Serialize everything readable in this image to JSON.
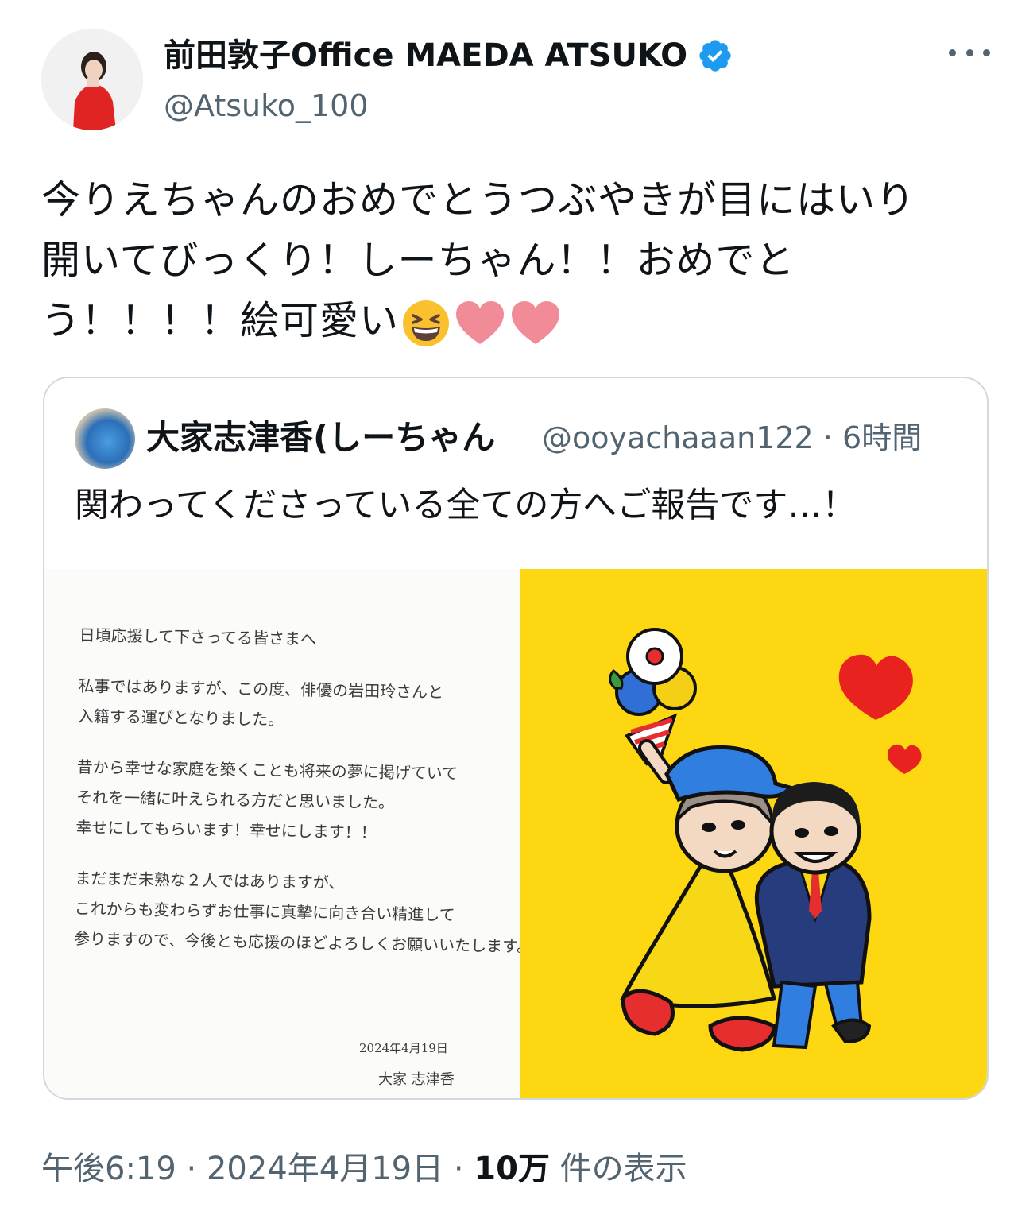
{
  "author": {
    "display_name": "前田敦子Office MAEDA ATSUKO",
    "handle": "@Atsuko_100"
  },
  "tweet": {
    "lines": [
      "今りえちゃんのおめでとうつぶやきが目にはいり",
      "開いてびっくり！しーちゃん！！おめでと",
      "う！！！！絵可愛い"
    ],
    "emojis": [
      "grinning-squinting-face",
      "pink-heart",
      "pink-heart"
    ]
  },
  "quote": {
    "display_name": "大家志津香(しーちゃん",
    "handle": "@ooyachaaan122",
    "separator": "·",
    "time": "6時間",
    "text": "関わってくださっている全ての方へご報告です…！",
    "letter": {
      "lines": [
        "日頃応援して下さってる皆さまへ",
        "",
        "私事ではありますが、この度、俳優の岩田玲さんと",
        "入籍する運びとなりました。",
        "",
        "昔から幸せな家庭を築くことも将来の夢に掲げていて",
        "それを一緒に叶えられる方だと思いました。",
        "幸せにしてもらいます！幸せにします！！",
        "",
        "まだまだ未熟な２人ではありますが、",
        "これからも変わらずお仕事に真摯に向き合い精進して",
        "参りますので、今後とも応援のほどよろしくお願いいたします。"
      ],
      "date": "2024年4月19日",
      "signature": "大家 志津香"
    }
  },
  "footer": {
    "time": "午後6:19",
    "sep1": " · ",
    "date": "2024年4月19日",
    "sep2": " · ",
    "views_count": "10万",
    "views_label": " 件の表示"
  },
  "colors": {
    "verified": "#1d9bf0",
    "illustration_bg": "#fdd812",
    "muted_text": "#536471",
    "border": "#cfd9de"
  }
}
